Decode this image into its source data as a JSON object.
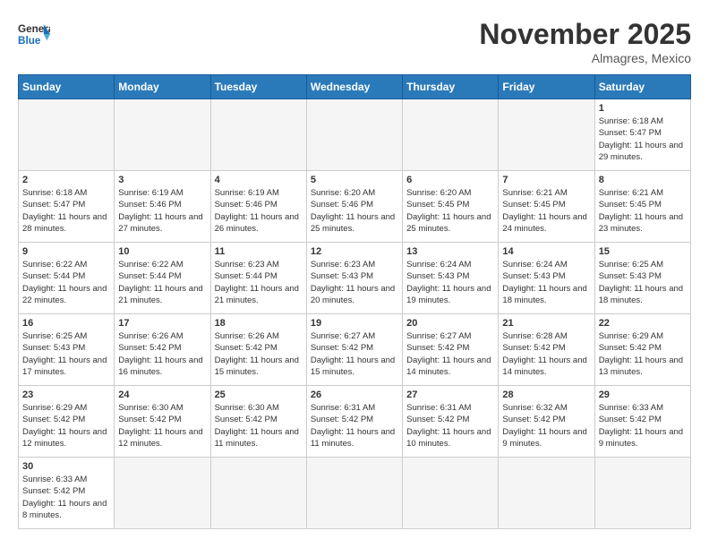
{
  "header": {
    "logo_general": "General",
    "logo_blue": "Blue",
    "month_year": "November 2025",
    "location": "Almagres, Mexico"
  },
  "days_of_week": [
    "Sunday",
    "Monday",
    "Tuesday",
    "Wednesday",
    "Thursday",
    "Friday",
    "Saturday"
  ],
  "weeks": [
    [
      {
        "day": "",
        "empty": true
      },
      {
        "day": "",
        "empty": true
      },
      {
        "day": "",
        "empty": true
      },
      {
        "day": "",
        "empty": true
      },
      {
        "day": "",
        "empty": true
      },
      {
        "day": "",
        "empty": true
      },
      {
        "day": "1",
        "sunrise": "Sunrise: 6:18 AM",
        "sunset": "Sunset: 5:47 PM",
        "daylight": "Daylight: 11 hours and 29 minutes."
      }
    ],
    [
      {
        "day": "2",
        "sunrise": "Sunrise: 6:18 AM",
        "sunset": "Sunset: 5:47 PM",
        "daylight": "Daylight: 11 hours and 28 minutes."
      },
      {
        "day": "3",
        "sunrise": "Sunrise: 6:19 AM",
        "sunset": "Sunset: 5:46 PM",
        "daylight": "Daylight: 11 hours and 27 minutes."
      },
      {
        "day": "4",
        "sunrise": "Sunrise: 6:19 AM",
        "sunset": "Sunset: 5:46 PM",
        "daylight": "Daylight: 11 hours and 26 minutes."
      },
      {
        "day": "5",
        "sunrise": "Sunrise: 6:20 AM",
        "sunset": "Sunset: 5:46 PM",
        "daylight": "Daylight: 11 hours and 25 minutes."
      },
      {
        "day": "6",
        "sunrise": "Sunrise: 6:20 AM",
        "sunset": "Sunset: 5:45 PM",
        "daylight": "Daylight: 11 hours and 25 minutes."
      },
      {
        "day": "7",
        "sunrise": "Sunrise: 6:21 AM",
        "sunset": "Sunset: 5:45 PM",
        "daylight": "Daylight: 11 hours and 24 minutes."
      },
      {
        "day": "8",
        "sunrise": "Sunrise: 6:21 AM",
        "sunset": "Sunset: 5:45 PM",
        "daylight": "Daylight: 11 hours and 23 minutes."
      }
    ],
    [
      {
        "day": "9",
        "sunrise": "Sunrise: 6:22 AM",
        "sunset": "Sunset: 5:44 PM",
        "daylight": "Daylight: 11 hours and 22 minutes."
      },
      {
        "day": "10",
        "sunrise": "Sunrise: 6:22 AM",
        "sunset": "Sunset: 5:44 PM",
        "daylight": "Daylight: 11 hours and 21 minutes."
      },
      {
        "day": "11",
        "sunrise": "Sunrise: 6:23 AM",
        "sunset": "Sunset: 5:44 PM",
        "daylight": "Daylight: 11 hours and 21 minutes."
      },
      {
        "day": "12",
        "sunrise": "Sunrise: 6:23 AM",
        "sunset": "Sunset: 5:43 PM",
        "daylight": "Daylight: 11 hours and 20 minutes."
      },
      {
        "day": "13",
        "sunrise": "Sunrise: 6:24 AM",
        "sunset": "Sunset: 5:43 PM",
        "daylight": "Daylight: 11 hours and 19 minutes."
      },
      {
        "day": "14",
        "sunrise": "Sunrise: 6:24 AM",
        "sunset": "Sunset: 5:43 PM",
        "daylight": "Daylight: 11 hours and 18 minutes."
      },
      {
        "day": "15",
        "sunrise": "Sunrise: 6:25 AM",
        "sunset": "Sunset: 5:43 PM",
        "daylight": "Daylight: 11 hours and 18 minutes."
      }
    ],
    [
      {
        "day": "16",
        "sunrise": "Sunrise: 6:25 AM",
        "sunset": "Sunset: 5:43 PM",
        "daylight": "Daylight: 11 hours and 17 minutes."
      },
      {
        "day": "17",
        "sunrise": "Sunrise: 6:26 AM",
        "sunset": "Sunset: 5:42 PM",
        "daylight": "Daylight: 11 hours and 16 minutes."
      },
      {
        "day": "18",
        "sunrise": "Sunrise: 6:26 AM",
        "sunset": "Sunset: 5:42 PM",
        "daylight": "Daylight: 11 hours and 15 minutes."
      },
      {
        "day": "19",
        "sunrise": "Sunrise: 6:27 AM",
        "sunset": "Sunset: 5:42 PM",
        "daylight": "Daylight: 11 hours and 15 minutes."
      },
      {
        "day": "20",
        "sunrise": "Sunrise: 6:27 AM",
        "sunset": "Sunset: 5:42 PM",
        "daylight": "Daylight: 11 hours and 14 minutes."
      },
      {
        "day": "21",
        "sunrise": "Sunrise: 6:28 AM",
        "sunset": "Sunset: 5:42 PM",
        "daylight": "Daylight: 11 hours and 14 minutes."
      },
      {
        "day": "22",
        "sunrise": "Sunrise: 6:29 AM",
        "sunset": "Sunset: 5:42 PM",
        "daylight": "Daylight: 11 hours and 13 minutes."
      }
    ],
    [
      {
        "day": "23",
        "sunrise": "Sunrise: 6:29 AM",
        "sunset": "Sunset: 5:42 PM",
        "daylight": "Daylight: 11 hours and 12 minutes."
      },
      {
        "day": "24",
        "sunrise": "Sunrise: 6:30 AM",
        "sunset": "Sunset: 5:42 PM",
        "daylight": "Daylight: 11 hours and 12 minutes."
      },
      {
        "day": "25",
        "sunrise": "Sunrise: 6:30 AM",
        "sunset": "Sunset: 5:42 PM",
        "daylight": "Daylight: 11 hours and 11 minutes."
      },
      {
        "day": "26",
        "sunrise": "Sunrise: 6:31 AM",
        "sunset": "Sunset: 5:42 PM",
        "daylight": "Daylight: 11 hours and 11 minutes."
      },
      {
        "day": "27",
        "sunrise": "Sunrise: 6:31 AM",
        "sunset": "Sunset: 5:42 PM",
        "daylight": "Daylight: 11 hours and 10 minutes."
      },
      {
        "day": "28",
        "sunrise": "Sunrise: 6:32 AM",
        "sunset": "Sunset: 5:42 PM",
        "daylight": "Daylight: 11 hours and 9 minutes."
      },
      {
        "day": "29",
        "sunrise": "Sunrise: 6:33 AM",
        "sunset": "Sunset: 5:42 PM",
        "daylight": "Daylight: 11 hours and 9 minutes."
      }
    ],
    [
      {
        "day": "30",
        "sunrise": "Sunrise: 6:33 AM",
        "sunset": "Sunset: 5:42 PM",
        "daylight": "Daylight: 11 hours and 8 minutes."
      },
      {
        "day": "",
        "empty": true
      },
      {
        "day": "",
        "empty": true
      },
      {
        "day": "",
        "empty": true
      },
      {
        "day": "",
        "empty": true
      },
      {
        "day": "",
        "empty": true
      },
      {
        "day": "",
        "empty": true
      }
    ]
  ]
}
